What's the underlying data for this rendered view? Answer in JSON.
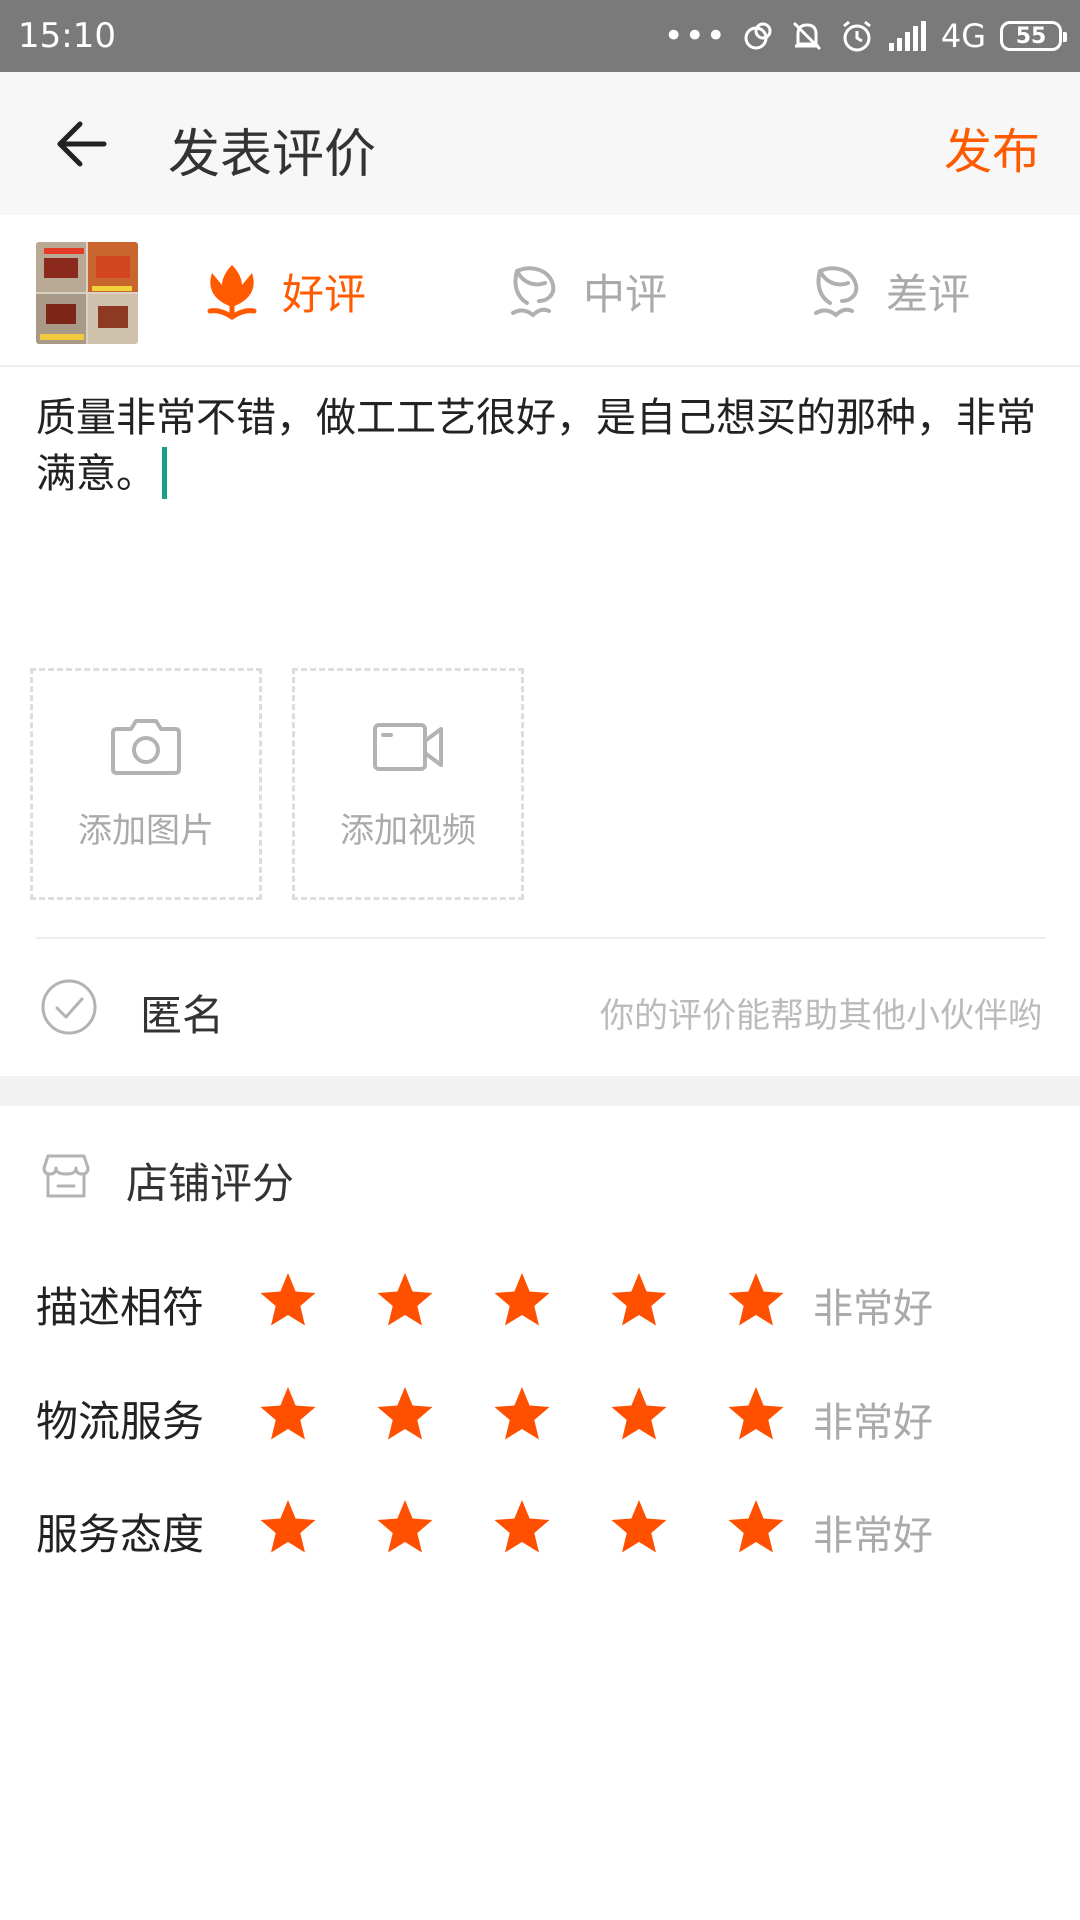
{
  "status_bar": {
    "time": "15:10",
    "network": "4G",
    "battery": "55",
    "icons": [
      "more-dots-icon",
      "sync-icon",
      "mute-icon",
      "alarm-icon",
      "signal-icon",
      "battery-icon"
    ]
  },
  "header": {
    "title": "发表评价",
    "publish_label": "发布",
    "accent_color": "#ff5a00"
  },
  "rating": {
    "options": [
      {
        "label": "好评",
        "icon": "flower-icon",
        "selected": true
      },
      {
        "label": "中评",
        "icon": "flower-outline-icon",
        "selected": false
      },
      {
        "label": "差评",
        "icon": "flower-outline-icon",
        "selected": false
      }
    ]
  },
  "review": {
    "text": "质量非常不错，做工工艺很好，是自己想买的那种，非常满意。"
  },
  "media": {
    "add_photo_label": "添加图片",
    "add_video_label": "添加视频"
  },
  "anonymous": {
    "label": "匿名",
    "hint": "你的评价能帮助其他小伙伴哟"
  },
  "store_rating": {
    "title": "店铺评分",
    "rows": [
      {
        "name": "描述相符",
        "stars": 5,
        "value_label": "非常好"
      },
      {
        "name": "物流服务",
        "stars": 5,
        "value_label": "非常好"
      },
      {
        "name": "服务态度",
        "stars": 5,
        "value_label": "非常好"
      }
    ],
    "star_color": "#ff5000"
  }
}
